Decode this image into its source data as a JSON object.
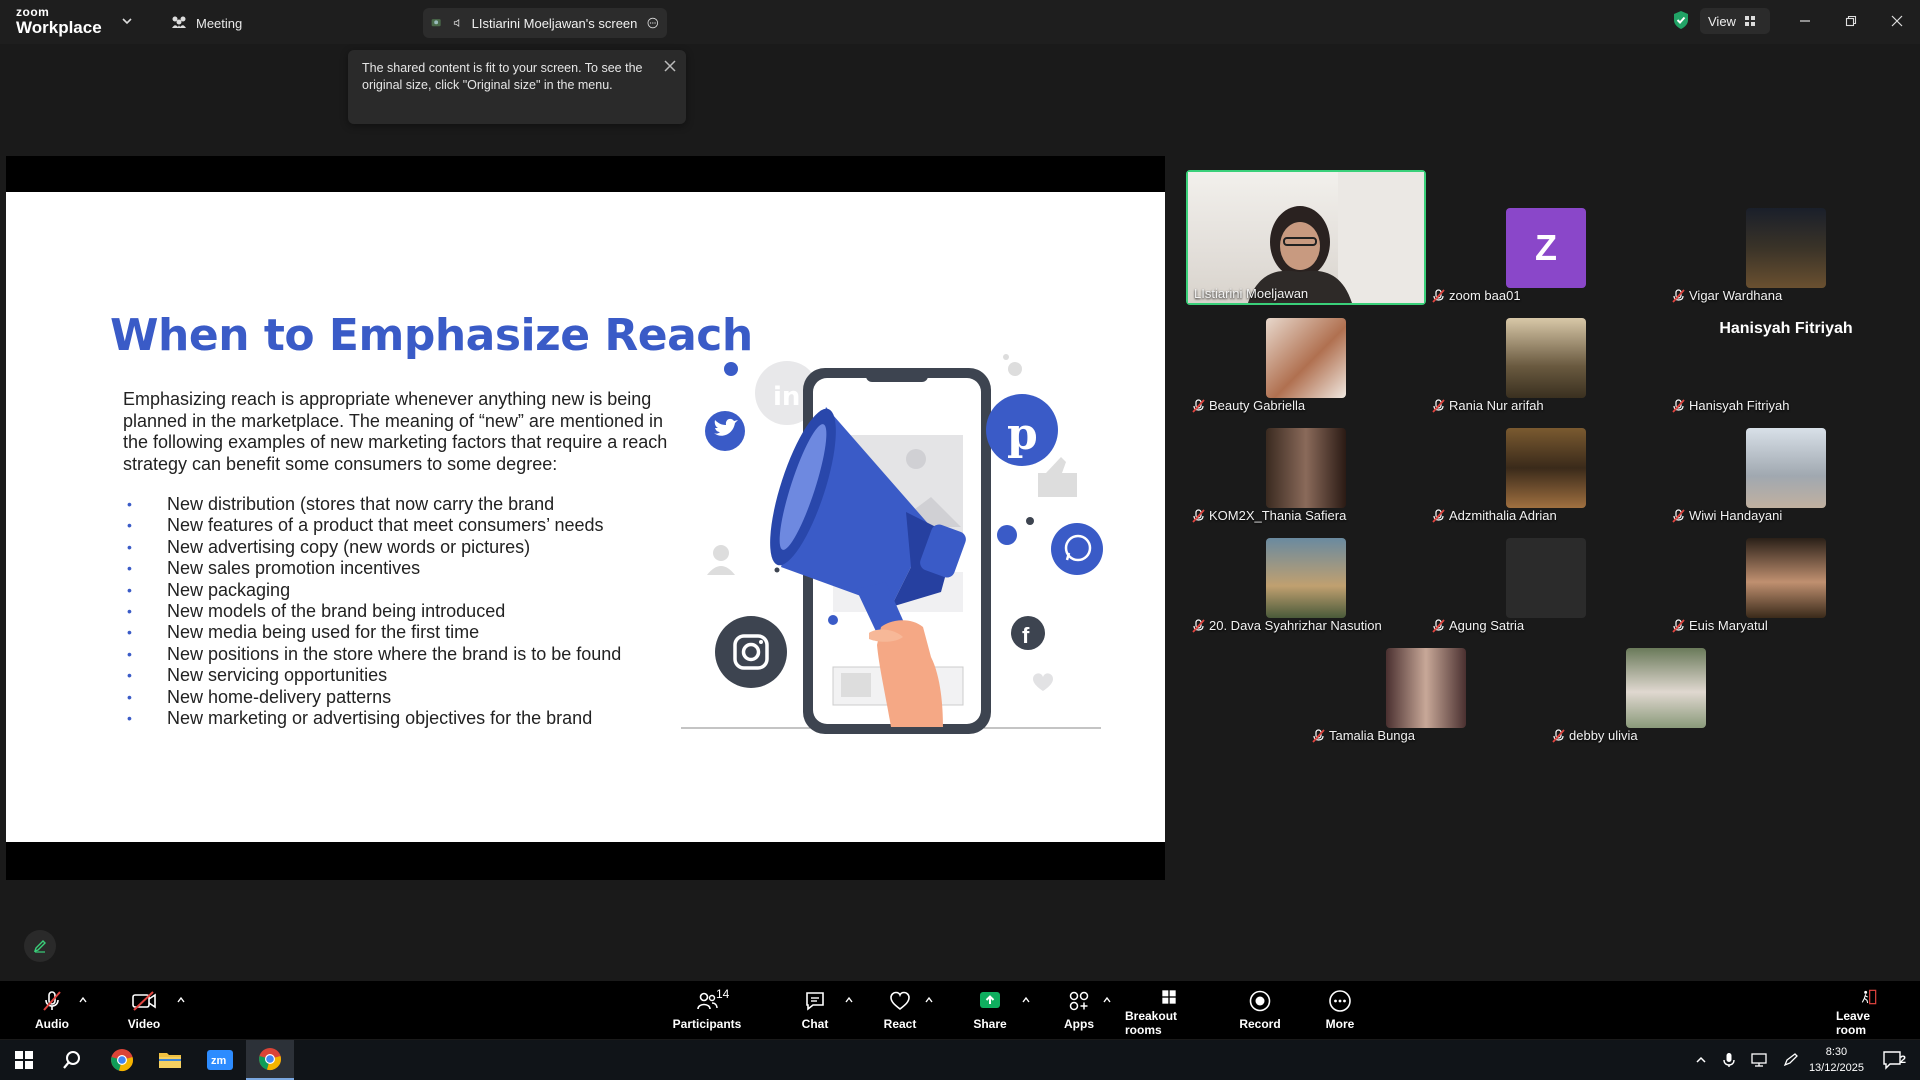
{
  "titlebar": {
    "logo_small": "zoom",
    "logo_big": "Workplace",
    "meeting_label": "Meeting",
    "share_label": "LIstiarini Moeljawan's screen",
    "view_label": "View"
  },
  "tooltip": {
    "text": "The shared content is fit to your screen. To see the original size, click \"Original size\" in the menu."
  },
  "slide": {
    "title": "When to Emphasize Reach",
    "intro": "Emphasizing reach is appropriate whenever anything new is being planned in the marketplace. The meaning of “new” are mentioned in the following examples of new marketing factors that require a reach strategy can benefit some consumers to some degree:",
    "bullets": [
      "New distribution (stores that now carry the brand",
      "New features of a product that meet consumers’ needs",
      "New advertising copy (new words or pictures)",
      "New sales promotion incentives",
      "New packaging",
      "New models of the brand being introduced",
      "New media being used for the first time",
      "New positions in the store where the brand is to be found",
      "New servicing opportunities",
      "New home-delivery patterns",
      "New marketing or advertising objectives for the brand"
    ]
  },
  "participants": [
    {
      "name": "LIstiarini Moeljawan",
      "type": "video"
    },
    {
      "name": "zoom baa01",
      "type": "letter",
      "letter": "Z"
    },
    {
      "name": "Vigar Wardhana",
      "type": "photo"
    },
    {
      "name": "Beauty Gabriella",
      "type": "photo"
    },
    {
      "name": "Rania Nur arifah",
      "type": "photo"
    },
    {
      "name": "Hanisyah Fitriyah",
      "type": "nameonly"
    },
    {
      "name": "KOM2X_Thania Safiera",
      "type": "photo"
    },
    {
      "name": "Adzmithalia Adrian",
      "type": "photo"
    },
    {
      "name": "Wiwi Handayani",
      "type": "photo"
    },
    {
      "name": "20. Dava Syahrizhar Nasution",
      "type": "photo"
    },
    {
      "name": "Agung Satria",
      "type": "blank"
    },
    {
      "name": "Euis Maryatul",
      "type": "photo"
    },
    {
      "name": "Tamalia Bunga",
      "type": "photo"
    },
    {
      "name": "debby ulivia",
      "type": "photo"
    }
  ],
  "toolbar": {
    "audio": "Audio",
    "video": "Video",
    "participants": "Participants",
    "participants_count": "14",
    "chat": "Chat",
    "react": "React",
    "share": "Share",
    "apps": "Apps",
    "breakout": "Breakout rooms",
    "record": "Record",
    "more": "More",
    "leave": "Leave room"
  },
  "taskbar": {
    "time": "8:30",
    "date": "13/12/2025",
    "notifications": "2"
  },
  "colors": {
    "accent_blue": "#3a5bc7",
    "zoom_purple": "#8a47c9",
    "active_speaker": "#3ad07a",
    "share_green": "#0fae5f",
    "mute_red": "#e0443f"
  }
}
